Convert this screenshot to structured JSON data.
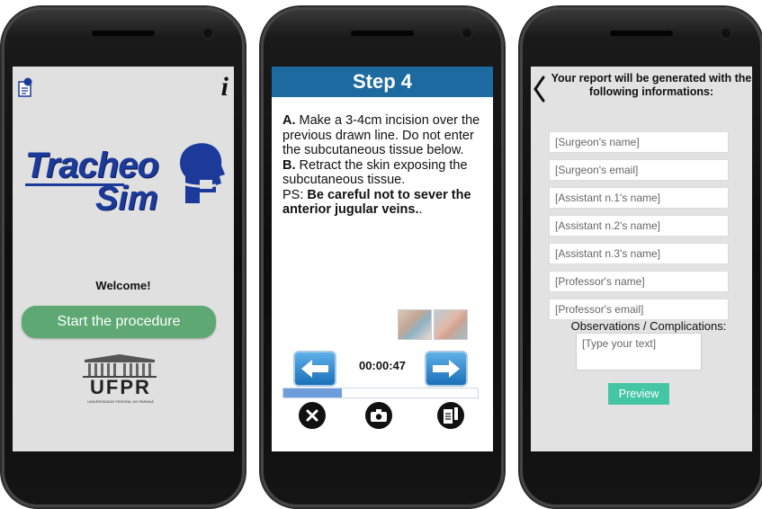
{
  "screen1": {
    "logo_line1": "Tracheo",
    "logo_line2": "Sim",
    "welcome": "Welcome!",
    "start_button": "Start the procedure",
    "institution": "UFPR",
    "institution_full": "UNIVERSIDADE FEDERAL DO PARANÁ",
    "icons": [
      "report-icon",
      "info-icon",
      "head-profile-icon",
      "university-building-icon"
    ],
    "brand_color": "#1b3a9a",
    "button_color": "#5ea874"
  },
  "screen2": {
    "title": "Step 4",
    "instruction": {
      "a_label": "A.",
      "a_text": " Make a 3-4cm incision over the previous drawn line. Do not enter the subcutaneous tissue below.",
      "b_label": "B.",
      "b_text": " Retract the skin exposing the subcutaneous tissue.",
      "ps_label": "PS: ",
      "ps_text": "Be careful not to sever the anterior jugular veins.",
      "ps_tail": "."
    },
    "timer": "00:00:47",
    "progress_fraction": 0.3,
    "icons": [
      "back-arrow-icon",
      "forward-arrow-icon",
      "close-icon",
      "camera-icon",
      "notes-icon"
    ],
    "header_color": "#1c6aa0"
  },
  "screen3": {
    "title": "Your report will be generated with the following informations:",
    "fields": [
      {
        "placeholder": "[Surgeon's name]"
      },
      {
        "placeholder": "[Surgeon's email]"
      },
      {
        "placeholder": "[Assistant n.1's name]"
      },
      {
        "placeholder": "[Assistant n.2's name]"
      },
      {
        "placeholder": "[Assistant n.3's name]"
      },
      {
        "placeholder": "[Professor's name]"
      },
      {
        "placeholder": "[Professor's email]"
      }
    ],
    "observations_label": "Observations / Complications:",
    "observations_placeholder": "[Type your text]",
    "preview_button": "Preview",
    "accent_color": "#44c6a4"
  }
}
